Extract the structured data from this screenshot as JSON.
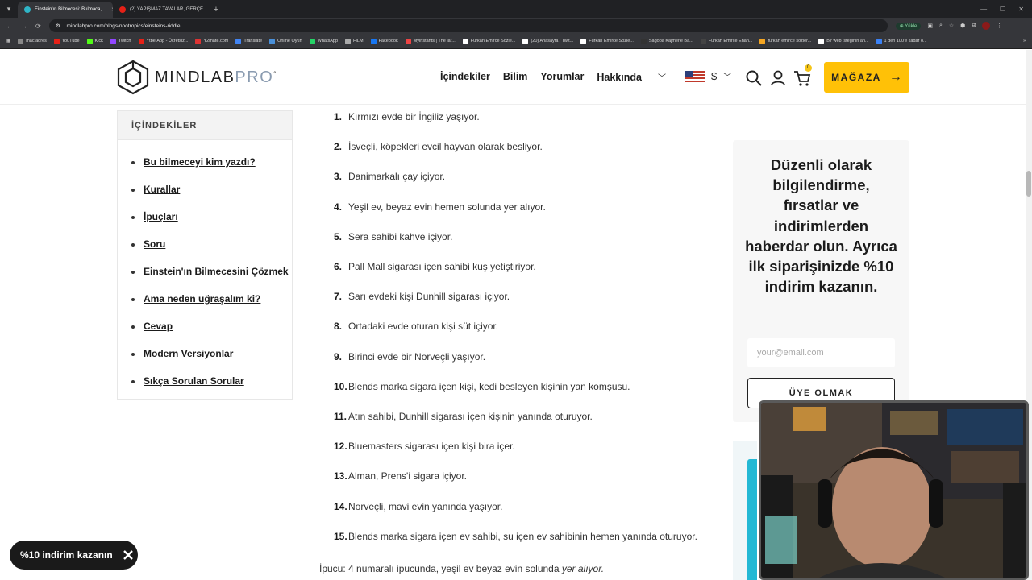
{
  "browser": {
    "tabs": [
      {
        "title": "Einstein'ın Bilmecesi: Bulmaca, ...",
        "active": true,
        "fav_color": "#2fb5c7"
      },
      {
        "title": "(2) YAPIŞMAZ TAVALAR, GERÇE...",
        "active": false,
        "fav_color": "#e62117"
      }
    ],
    "url": "mindlabpro.com/blogs/nootropics/einsteins-riddle",
    "install_label": "Yükle",
    "bookmarks": [
      {
        "label": "mac adres",
        "color": "#888"
      },
      {
        "label": "YouTube",
        "color": "#e62117"
      },
      {
        "label": "Kick",
        "color": "#53fc18"
      },
      {
        "label": "Twitch",
        "color": "#9146ff"
      },
      {
        "label": "Ytbe.App - Ücretsiz...",
        "color": "#e62117"
      },
      {
        "label": "Y2mate.com",
        "color": "#d33"
      },
      {
        "label": "Translate",
        "color": "#4285f4"
      },
      {
        "label": "Online Oyun",
        "color": "#4a90d9"
      },
      {
        "label": "WhatsApp",
        "color": "#25d366"
      },
      {
        "label": "FILM",
        "color": "#aaa"
      },
      {
        "label": "Facebook",
        "color": "#1877f2"
      },
      {
        "label": "Myinstants | The lar...",
        "color": "#e44"
      },
      {
        "label": "Furkan Emirce Sözle...",
        "color": "#fff"
      },
      {
        "label": "(20) Anasayfa / Twit...",
        "color": "#fff"
      },
      {
        "label": "Furkan Emirce Sözle...",
        "color": "#fff"
      },
      {
        "label": "Sagopa Kajmer'e Ba...",
        "color": "#333"
      },
      {
        "label": "Furkan Emirce Ehan...",
        "color": "#444"
      },
      {
        "label": "furkan emirce sözler...",
        "color": "#f5a623"
      },
      {
        "label": "Bir web isteğinin an...",
        "color": "#fff"
      },
      {
        "label": "1 den 100'e kadar o...",
        "color": "#3b82f6"
      }
    ]
  },
  "header": {
    "logo_main": "MINDLAB",
    "logo_pro": "PRO",
    "nav": [
      "İçindekiler",
      "Bilim",
      "Yorumlar",
      "Hakkında"
    ],
    "currency": "$",
    "cart_count": "0",
    "shop_label": "MAĞAZA"
  },
  "toc": {
    "heading": "İÇİNDEKİLER",
    "items": [
      "Bu bilmeceyi kim yazdı?",
      "Kurallar",
      "İpuçları",
      "Soru",
      "Einstein'ın Bilmecesini Çözmek",
      "Ama neden uğraşalım ki?",
      "Cevap",
      "Modern Versiyonlar",
      "Sıkça Sorulan Sorular"
    ]
  },
  "clues": [
    {
      "n": "1.",
      "text": "Kırmızı evde bir İngiliz yaşıyor."
    },
    {
      "n": "2.",
      "text": "İsveçli, köpekleri evcil hayvan olarak besliyor."
    },
    {
      "n": "3.",
      "text": "Danimarkalı çay içiyor."
    },
    {
      "n": "4.",
      "text": "Yeşil ev, beyaz evin hemen solunda yer alıyor."
    },
    {
      "n": "5.",
      "text": "Sera sahibi kahve içiyor."
    },
    {
      "n": "6.",
      "text": "Pall Mall sigarası içen sahibi kuş yetiştiriyor."
    },
    {
      "n": "7.",
      "text": "Sarı evdeki kişi Dunhill sigarası içiyor."
    },
    {
      "n": "8.",
      "text": "Ortadaki evde oturan kişi süt içiyor."
    },
    {
      "n": "9.",
      "text": "Birinci evde bir Norveçli yaşıyor."
    },
    {
      "n": "10.",
      "text": "Blends marka sigara içen kişi, kedi besleyen kişinin yan komşusu."
    },
    {
      "n": "11.",
      "text": "Atın sahibi, Dunhill sigarası içen kişinin yanında oturuyor."
    },
    {
      "n": "12.",
      "text": "Bluemasters sigarası içen kişi bira içer."
    },
    {
      "n": "13.",
      "text": "Alman, Prens'i sigara içiyor."
    },
    {
      "n": "14.",
      "text": "Norveçli, mavi evin yanında yaşıyor."
    },
    {
      "n": "15.",
      "text": "Blends marka sigara içen ev sahibi, su içen ev sahibinin hemen yanında oturuyor."
    }
  ],
  "hint": {
    "prefix": "İpucu: 4 numaralı ipucunda, yeşil ev beyaz evin solunda ",
    "emph": "yer alıyor."
  },
  "newsletter": {
    "text": "Düzenli olarak bilgilendirme, fırsatlar ve indirimlerden haberdar olun. Ayrıca ilk siparişinizde %10 indirim kazanın.",
    "placeholder": "your@email.com",
    "button": "ÜYE OLMAK"
  },
  "promo": {
    "label": "%10 indirim kazanın"
  },
  "colors": {
    "accent": "#ffc107",
    "dark": "#1a1a1a",
    "cyan": "#23b8d4"
  }
}
